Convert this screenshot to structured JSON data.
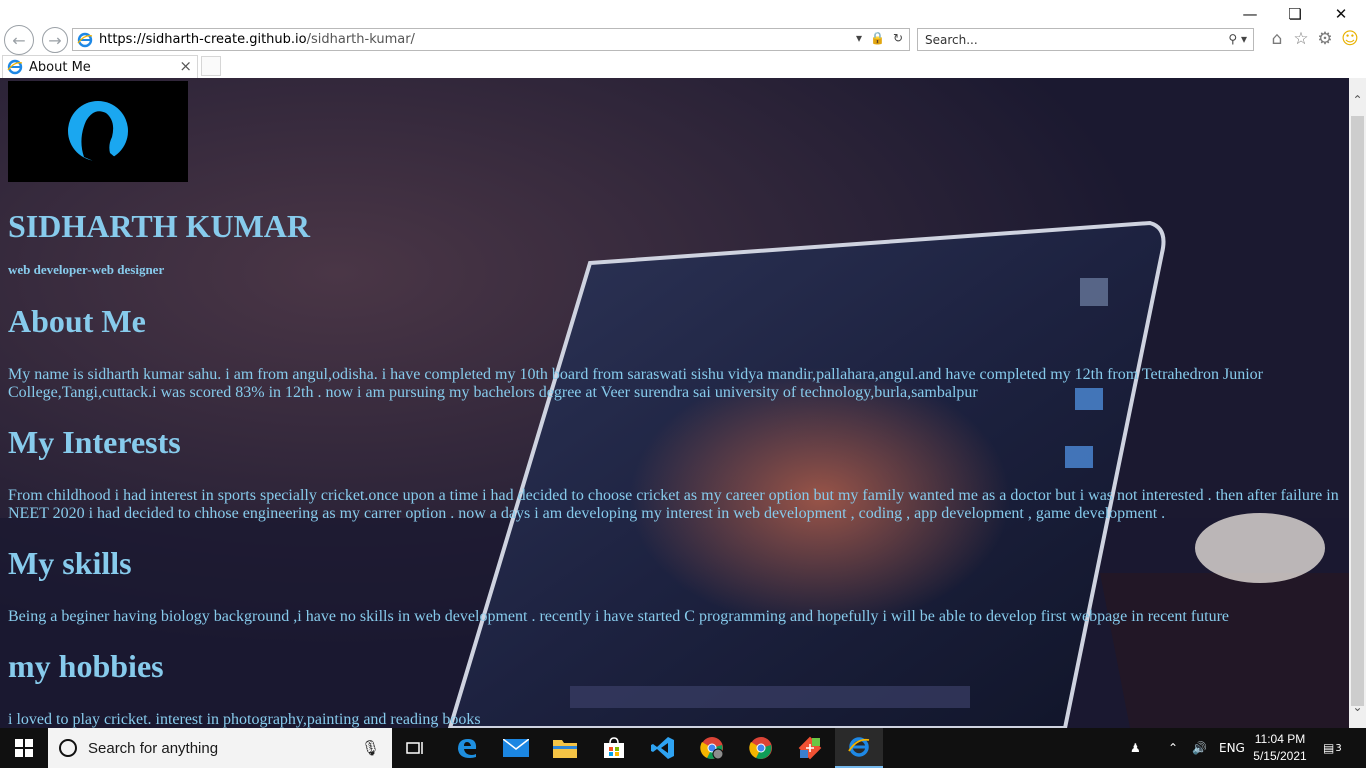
{
  "browser": {
    "url_host": "https://sidharth-create.github.io",
    "url_path": "/sidharth-kumar/",
    "search_placeholder": "Search...",
    "tab_title": "About Me",
    "tab_close": "×"
  },
  "page": {
    "name": "SIDHARTH KUMAR",
    "tagline": "web developer-web designer",
    "sections": [
      {
        "heading": "About Me",
        "text": "My name is sidharth kumar sahu. i am from angul,odisha. i have completed my 10th board from saraswati sishu vidya mandir,pallahara,angul.and have completed my 12th from Tetrahedron Junior College,Tangi,cuttack.i was scored 83% in 12th . now i am pursuing my bachelors degree at Veer surendra sai university of technology,burla,sambalpur"
      },
      {
        "heading": "My Interests",
        "text": "From childhood i had interest in sports specially cricket.once upon a time i had decided to choose cricket as my career option but my family wanted me as a doctor but i was not interested . then after failure in NEET 2020 i had decided to chhose engineering as my carrer option . now a days i am developing my interest in web development , coding , app development , game development ."
      },
      {
        "heading": "My skills",
        "text": "Being a beginer having biology background ,i have no skills in web development . recently i have started C programming and hopefully i will be able to develop first webpage in recent future"
      },
      {
        "heading": "my hobbies",
        "text": "i loved to play cricket. interest in photography,painting and reading books"
      }
    ]
  },
  "taskbar": {
    "search_text": "Search for anything",
    "language": "ENG",
    "time": "11:04 PM",
    "date": "5/15/2021",
    "notification_count": "3"
  },
  "colors": {
    "text_accent": "#87cbec",
    "taskbar_bg": "#101010",
    "active_underline": "#76b9ed"
  }
}
